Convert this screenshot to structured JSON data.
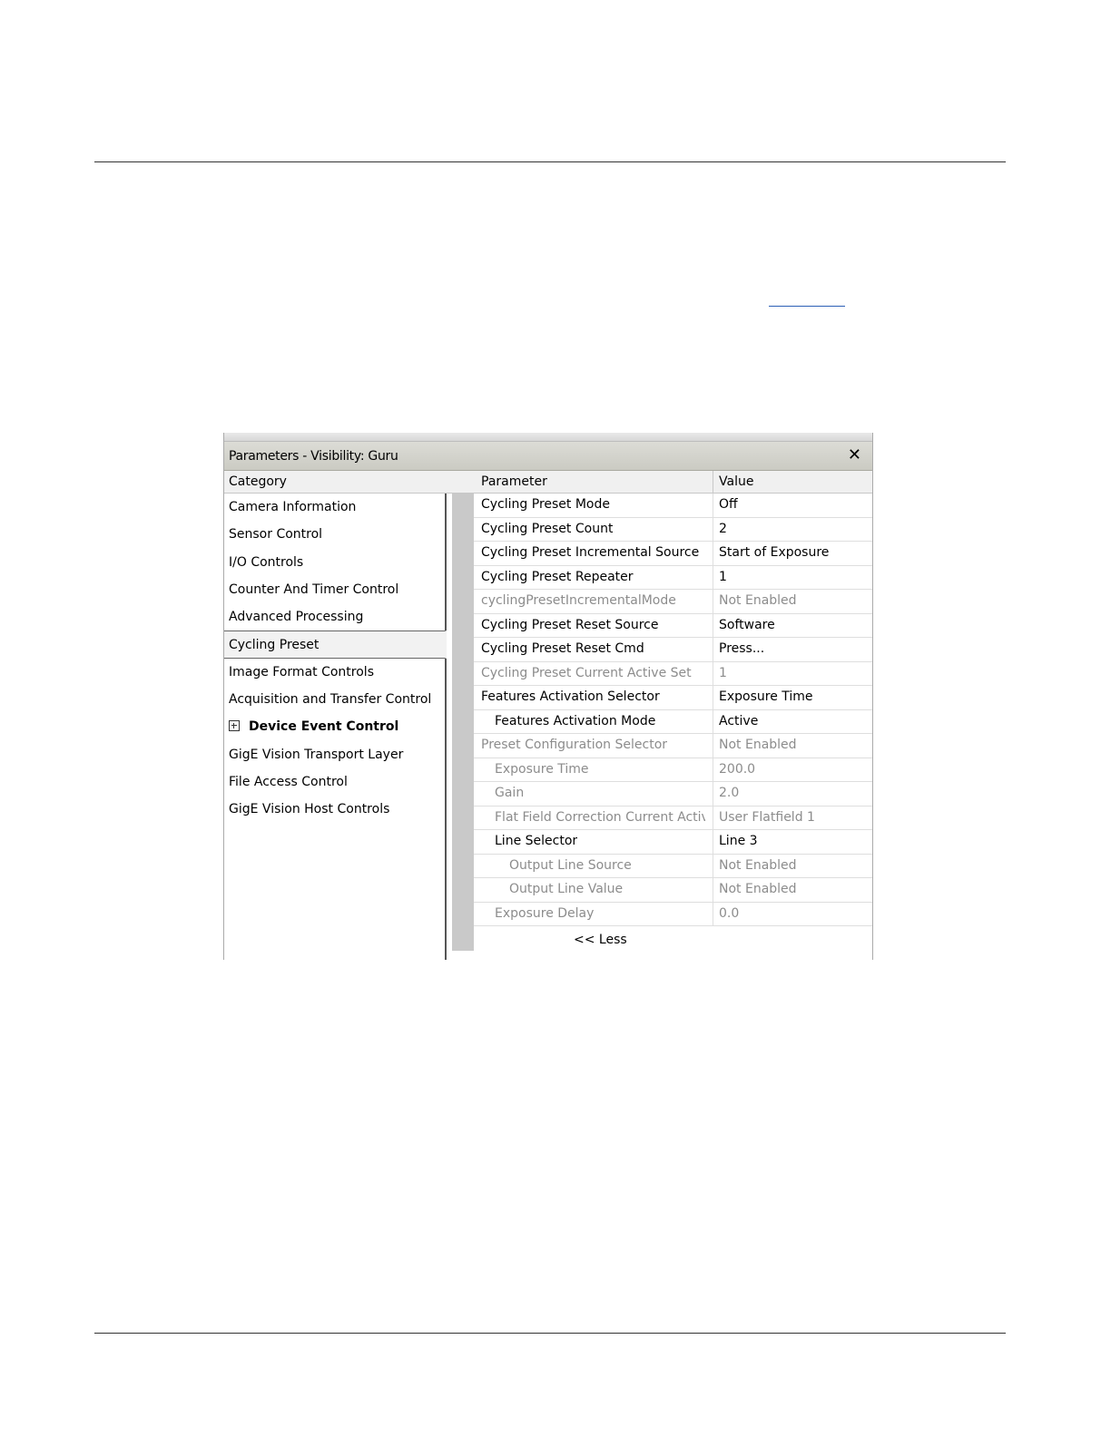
{
  "window": {
    "title": "Parameters - Visibility: Guru",
    "close_symbol": "✕"
  },
  "category_panel": {
    "header": "Category",
    "items": [
      {
        "label": "Camera Information",
        "state": "normal"
      },
      {
        "label": "Sensor Control",
        "state": "normal"
      },
      {
        "label": "I/O Controls",
        "state": "normal"
      },
      {
        "label": "Counter And Timer Control",
        "state": "normal"
      },
      {
        "label": "Advanced Processing",
        "state": "normal"
      },
      {
        "label": "Cycling Preset",
        "state": "selected"
      },
      {
        "label": "Image Format Controls",
        "state": "normal"
      },
      {
        "label": "Acquisition and Transfer Control",
        "state": "normal"
      },
      {
        "label": "Device Event Control",
        "state": "collapsed-bold"
      },
      {
        "label": "GigE Vision Transport Layer",
        "state": "normal"
      },
      {
        "label": "File Access Control",
        "state": "normal"
      },
      {
        "label": "GigE Vision Host Controls",
        "state": "normal"
      }
    ]
  },
  "parameter_grid": {
    "header_parameter": "Parameter",
    "header_value": "Value",
    "rows": [
      {
        "parameter": "Cycling Preset Mode",
        "value": "Off",
        "indent": 0,
        "enabled": true
      },
      {
        "parameter": "Cycling Preset Count",
        "value": "2",
        "indent": 0,
        "enabled": true
      },
      {
        "parameter": "Cycling Preset Incremental Source",
        "value": "Start of Exposure",
        "indent": 0,
        "enabled": true
      },
      {
        "parameter": "Cycling Preset Repeater",
        "value": "1",
        "indent": 0,
        "enabled": true
      },
      {
        "parameter": "cyclingPresetIncrementalMode",
        "value": "Not Enabled",
        "indent": 0,
        "enabled": false
      },
      {
        "parameter": "Cycling Preset Reset Source",
        "value": "Software",
        "indent": 0,
        "enabled": true
      },
      {
        "parameter": "Cycling Preset Reset Cmd",
        "value": "Press...",
        "indent": 0,
        "enabled": true
      },
      {
        "parameter": "Cycling Preset Current Active Set",
        "value": "1",
        "indent": 0,
        "enabled": false
      },
      {
        "parameter": "Features Activation Selector",
        "value": "Exposure Time",
        "indent": 0,
        "enabled": true
      },
      {
        "parameter": "Features Activation Mode",
        "value": "Active",
        "indent": 1,
        "enabled": true
      },
      {
        "parameter": "Preset Configuration Selector",
        "value": "Not Enabled",
        "indent": 0,
        "enabled": false
      },
      {
        "parameter": "Exposure Time",
        "value": "200.0",
        "indent": 1,
        "enabled": false
      },
      {
        "parameter": "Gain",
        "value": "2.0",
        "indent": 1,
        "enabled": false
      },
      {
        "parameter": "Flat Field Correction Current Activ...",
        "value": "User Flatfield 1",
        "indent": 1,
        "enabled": false
      },
      {
        "parameter": "Line Selector",
        "value": "Line 3",
        "indent": 1,
        "enabled": true
      },
      {
        "parameter": "Output Line Source",
        "value": "Not Enabled",
        "indent": 2,
        "enabled": false
      },
      {
        "parameter": "Output Line Value",
        "value": "Not Enabled",
        "indent": 2,
        "enabled": false
      },
      {
        "parameter": "Exposure Delay",
        "value": "0.0",
        "indent": 1,
        "enabled": false
      }
    ],
    "less_label": "<< Less"
  }
}
